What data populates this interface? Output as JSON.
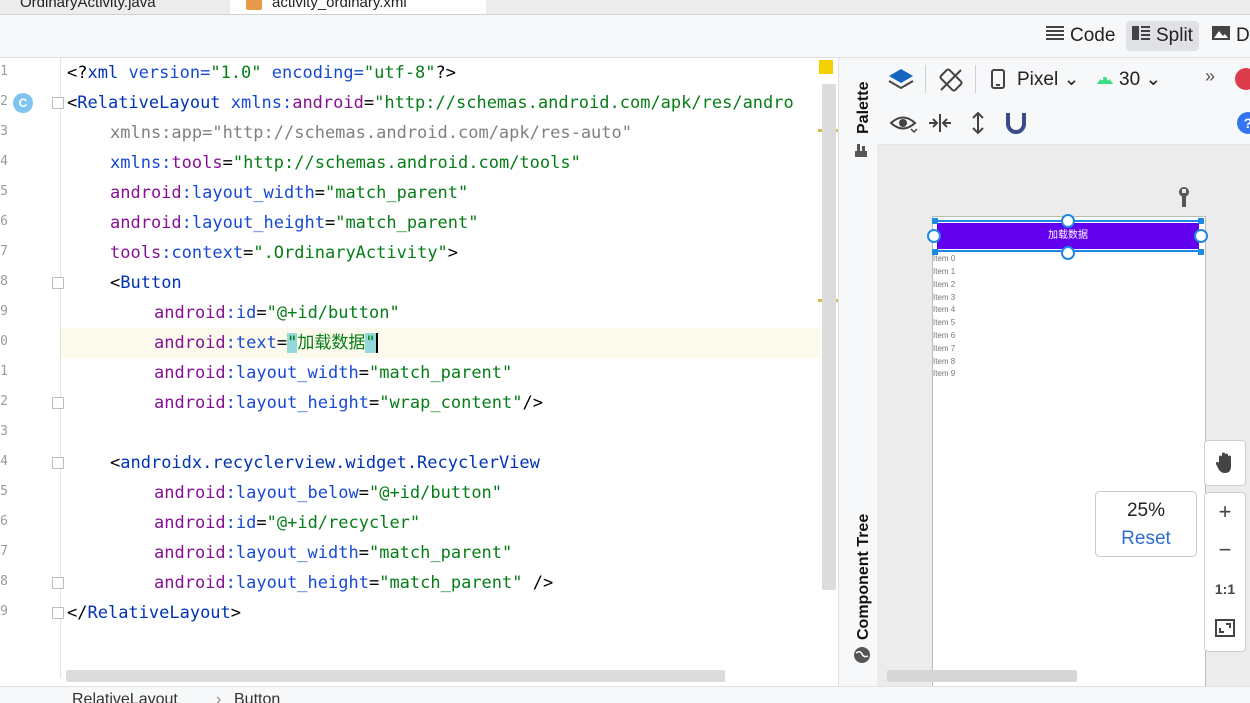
{
  "tabs": {
    "tab1": "OrdinaryActivity.java",
    "tab2": "activity_ordinary.xml"
  },
  "view_modes": {
    "code": "Code",
    "split": "Split",
    "design": "D"
  },
  "gutter": {
    "line_numbers": [
      "1",
      "2",
      "3",
      "4",
      "5",
      "6",
      "7",
      "8",
      "9",
      "0",
      "1",
      "2",
      "3",
      "4",
      "5",
      "6",
      "7",
      "8",
      "9"
    ],
    "class_badge": "C"
  },
  "code": {
    "l1": {
      "a": "<?",
      "b": "xml",
      "c": " version=",
      "d": "\"1.0\"",
      "e": " encoding=",
      "f": "\"utf-8\"",
      "g": "?>"
    },
    "l2": {
      "a": "<",
      "b": "RelativeLayout",
      "c": " xmlns:",
      "d": "android",
      "e": "=",
      "f": "\"http://schemas.android.com/apk/res/andro"
    },
    "l3": {
      "a": "xmlns:app=",
      "b": "\"http://schemas.android.com/apk/res-auto\""
    },
    "l4": {
      "a": "xmlns:",
      "b": "tools",
      "c": "=",
      "d": "\"http://schemas.android.com/tools\""
    },
    "l5": {
      "a": "android",
      "b": ":layout_width",
      "c": "=",
      "d": "\"match_parent\""
    },
    "l6": {
      "a": "android",
      "b": ":layout_height",
      "c": "=",
      "d": "\"match_parent\""
    },
    "l7": {
      "a": "tools",
      "b": ":context",
      "c": "=",
      "d": "\".OrdinaryActivity\"",
      "e": ">"
    },
    "l8": {
      "a": "<",
      "b": "Button"
    },
    "l9": {
      "a": "android",
      "b": ":id",
      "c": "=",
      "d": "\"@+id/button\""
    },
    "l10": {
      "a": "android",
      "b": ":text",
      "c": "=",
      "d": "\"",
      "e": "加载数据",
      "f": "\""
    },
    "l11": {
      "a": "android",
      "b": ":layout_width",
      "c": "=",
      "d": "\"match_parent\""
    },
    "l12": {
      "a": "android",
      "b": ":layout_height",
      "c": "=",
      "d": "\"wrap_content\"",
      "e": "/>"
    },
    "l14": {
      "a": "<",
      "b": "androidx.recyclerview.widget.RecyclerView"
    },
    "l15": {
      "a": "android",
      "b": ":layout_below",
      "c": "=",
      "d": "\"@+id/button\""
    },
    "l16": {
      "a": "android",
      "b": ":id",
      "c": "=",
      "d": "\"@+id/recycler\""
    },
    "l17": {
      "a": "android",
      "b": ":layout_width",
      "c": "=",
      "d": "\"match_parent\""
    },
    "l18": {
      "a": "android",
      "b": ":layout_height",
      "c": "=",
      "d": "\"match_parent\"",
      "e": " />"
    },
    "l19": {
      "a": "</",
      "b": "RelativeLayout",
      "c": ">"
    }
  },
  "side_panels": {
    "palette": "Palette",
    "component_tree": "Component Tree"
  },
  "design_toolbar": {
    "device": "Pixel",
    "api": "30",
    "more": "»"
  },
  "preview": {
    "button_text": "加载数据",
    "items": [
      "Item 0",
      "Item 1",
      "Item 2",
      "Item 3",
      "Item 4",
      "Item 5",
      "Item 6",
      "Item 7",
      "Item 8",
      "Item 9"
    ]
  },
  "zoom": {
    "percent": "25%",
    "reset": "Reset",
    "one_to_one": "1:1"
  },
  "breadcrumb": [
    "RelativeLayout",
    "Button"
  ],
  "colors": {
    "preview_button": "#6200ee",
    "selection": "#1e88e5",
    "accent_tab": "#3574f0"
  }
}
